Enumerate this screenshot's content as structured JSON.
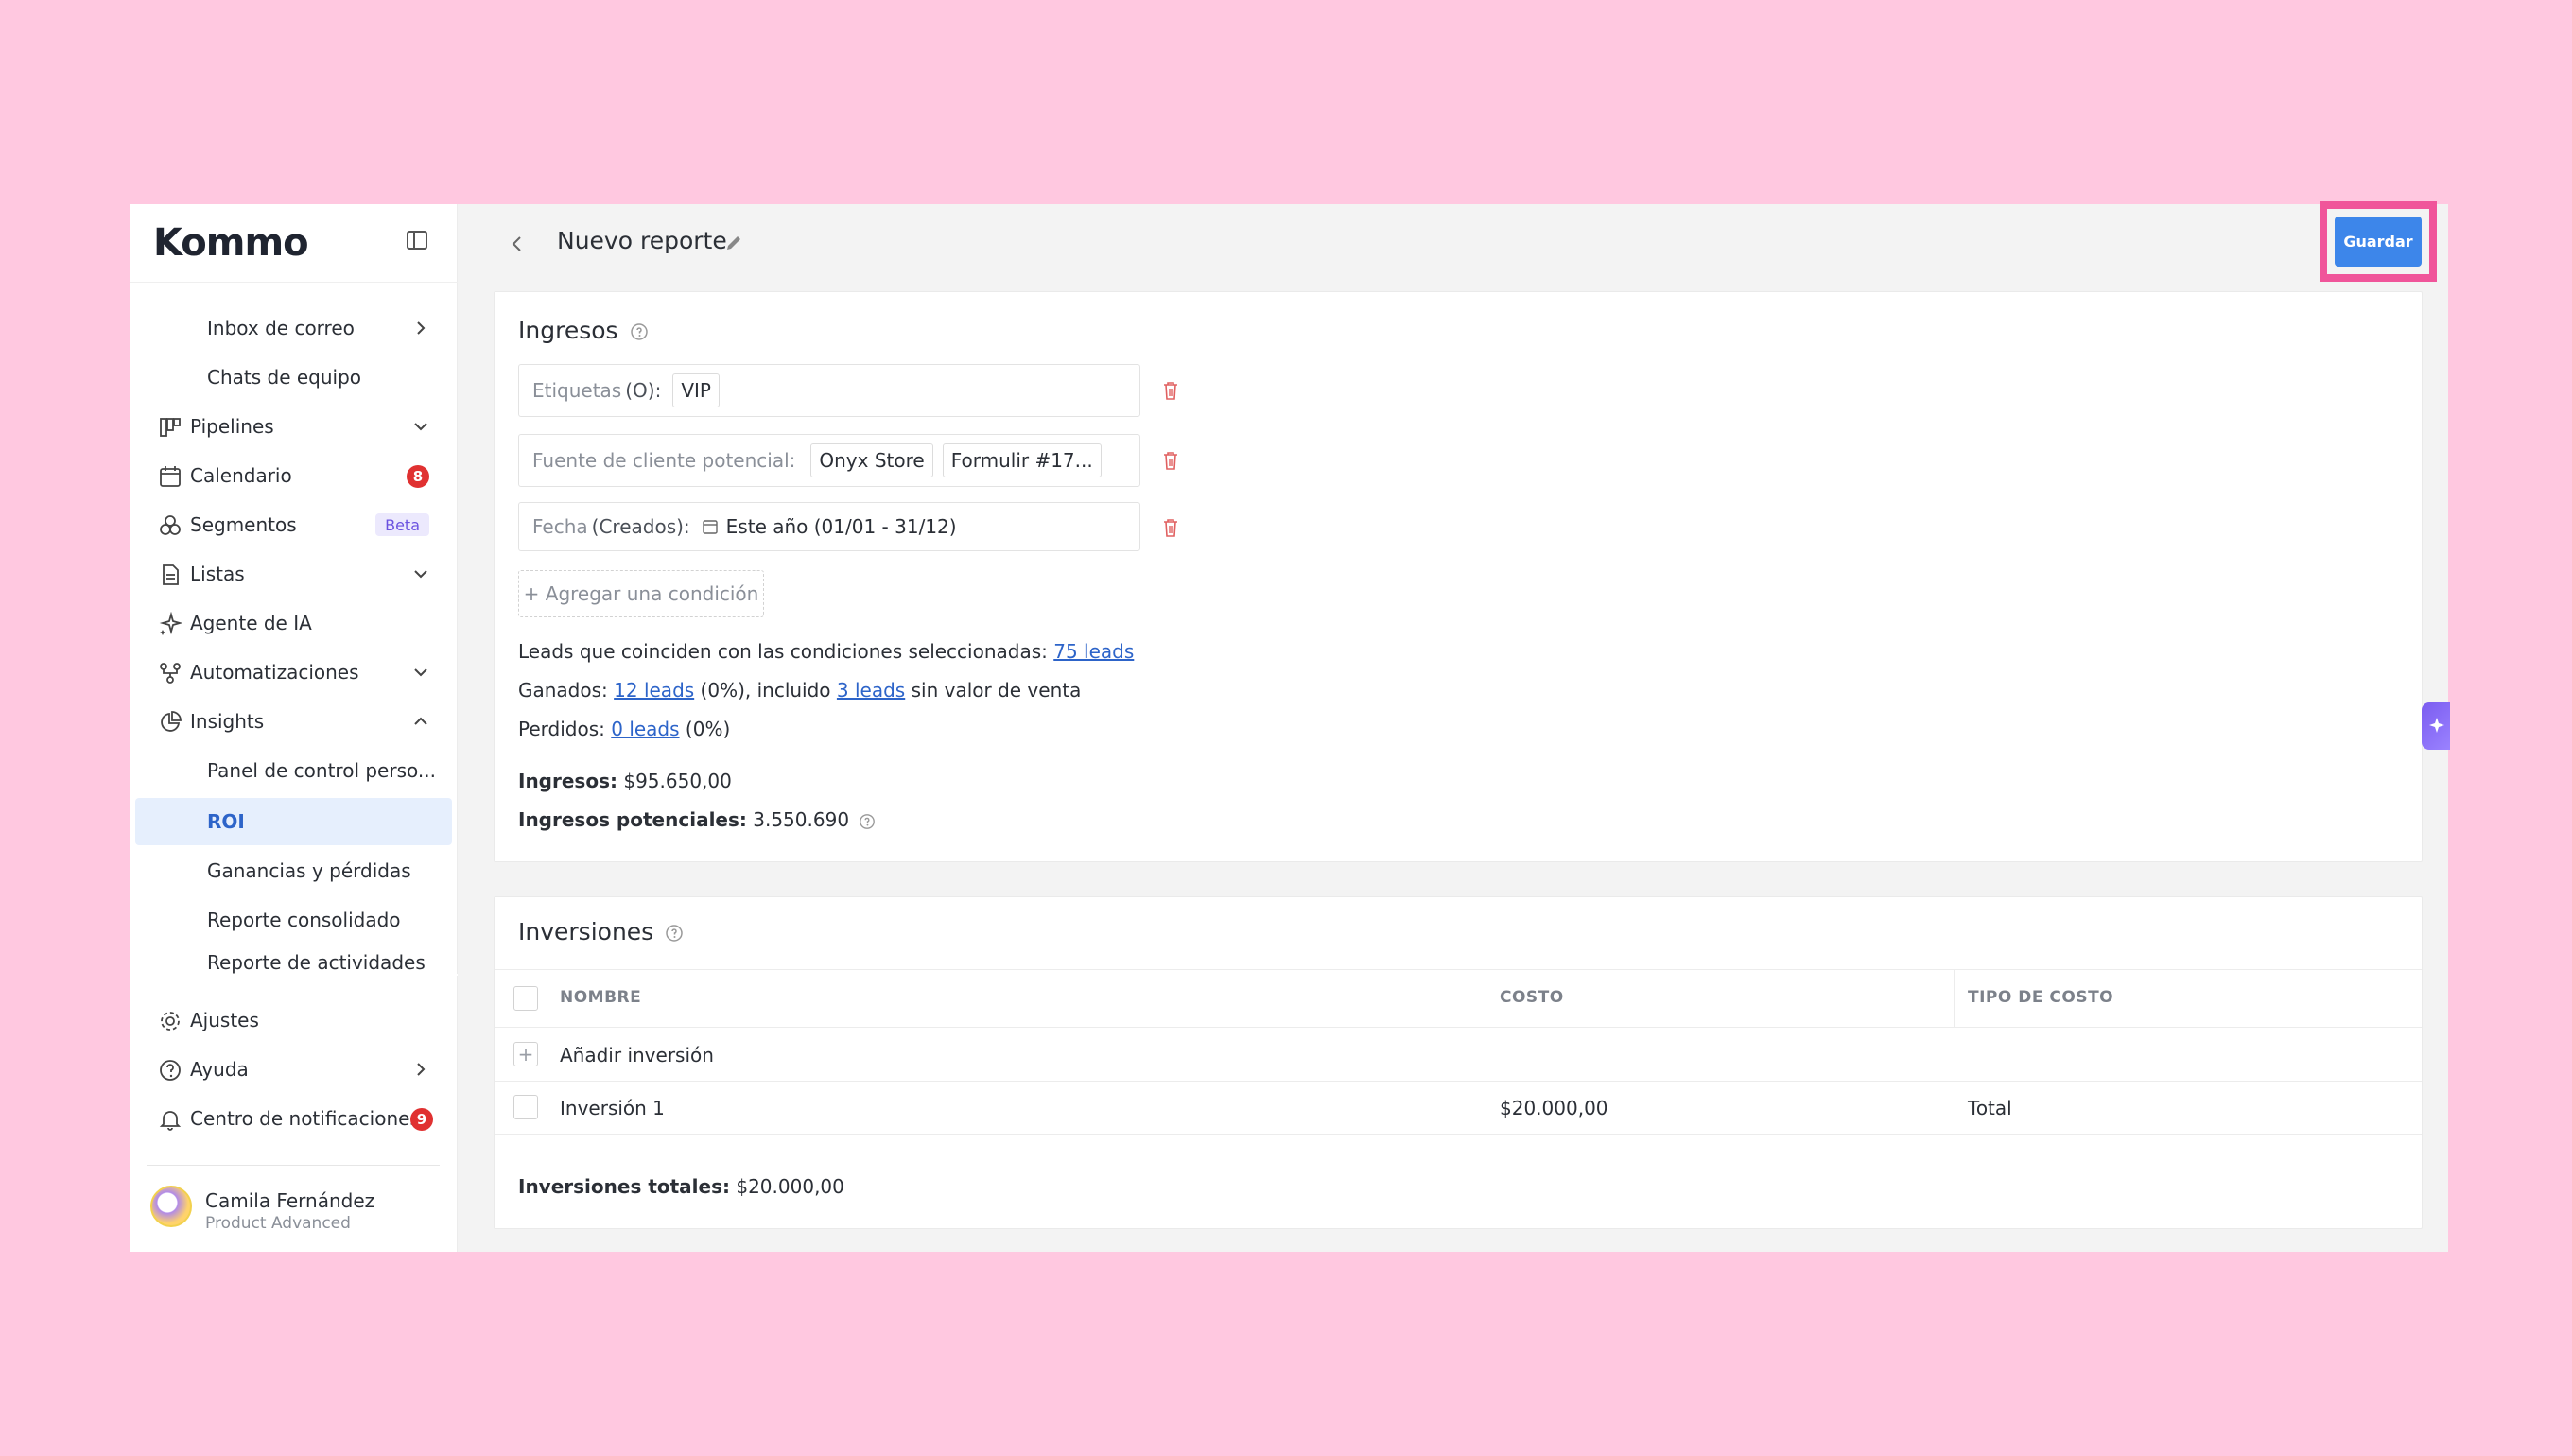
{
  "app": {
    "logo": "Kommo"
  },
  "sidebar": {
    "items": [
      {
        "label": "Inbox de correo"
      },
      {
        "label": "Chats de equipo"
      },
      {
        "label": "Pipelines"
      },
      {
        "label": "Calendario",
        "badge": "8"
      },
      {
        "label": "Segmentos",
        "badge": "Beta"
      },
      {
        "label": "Listas"
      },
      {
        "label": "Agente de IA"
      },
      {
        "label": "Automatizaciones"
      },
      {
        "label": "Insights"
      },
      {
        "label": "Panel de control perso..."
      },
      {
        "label": "ROI"
      },
      {
        "label": "Ganancias y pérdidas"
      },
      {
        "label": "Reporte consolidado"
      },
      {
        "label": "Reporte de actividades"
      }
    ],
    "bottom": [
      {
        "label": "Ajustes"
      },
      {
        "label": "Ayuda"
      },
      {
        "label": "Centro de notificaciones",
        "badge": "9"
      }
    ],
    "profile": {
      "name": "Camila Fernández",
      "role": "Product Advanced"
    }
  },
  "header": {
    "title": "Nuevo reporte",
    "save_label": "Guardar"
  },
  "ingresos": {
    "title": "Ingresos",
    "conditions": [
      {
        "key": "Etiquetas",
        "paren": "(O):",
        "chips": [
          "VIP"
        ]
      },
      {
        "key": "Fuente de cliente potencial:",
        "paren": "",
        "chips": [
          "Onyx Store",
          "Formulir #17..."
        ]
      },
      {
        "key": "Fecha",
        "paren": "(Creados):",
        "date": "Este año (01/01 - 31/12)"
      }
    ],
    "add_condition": "+ Agregar una condición",
    "matching": {
      "text": "Leads que coinciden con las condiciones seleccionadas:",
      "link": "75 leads"
    },
    "won": {
      "prefix": "Ganados:",
      "link1": "12 leads",
      "mid": "(0%), incluido",
      "link2": "3 leads",
      "suffix": "sin valor de venta"
    },
    "lost": {
      "prefix": "Perdidos:",
      "link": "0 leads",
      "suffix": "(0%)"
    },
    "revenue": {
      "label": "Ingresos:",
      "value": "$95.650,00"
    },
    "potential": {
      "label": "Ingresos potenciales:",
      "value": "3.550.690"
    }
  },
  "inversiones": {
    "title": "Inversiones",
    "columns": [
      "NOMBRE",
      "COSTO",
      "TIPO DE COSTO"
    ],
    "add_label": "Añadir inversión",
    "rows": [
      {
        "name": "Inversión 1",
        "cost": "$20.000,00",
        "type": "Total"
      }
    ],
    "total": {
      "label": "Inversiones totales:",
      "value": "$20.000,00"
    }
  },
  "colors": {
    "accent": "#3d86ea",
    "highlight": "#f0559a",
    "link": "#2d64c9",
    "background": "#ffc8e0"
  }
}
